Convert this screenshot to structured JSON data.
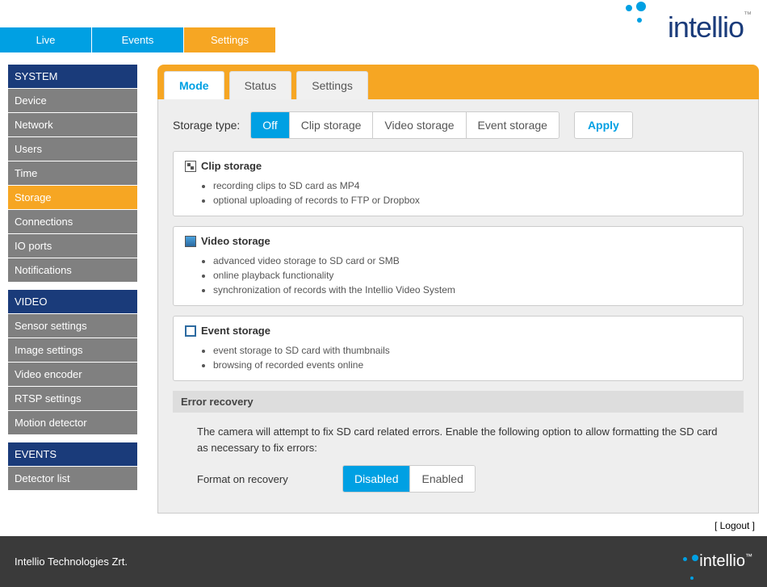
{
  "topnav": {
    "items": [
      {
        "label": "Live",
        "style": "blue"
      },
      {
        "label": "Events",
        "style": "blue"
      },
      {
        "label": "Settings",
        "style": "orange",
        "active": true
      }
    ]
  },
  "logo": {
    "text": "intellio",
    "tm": "™"
  },
  "sidebar": {
    "sections": [
      {
        "title": "SYSTEM",
        "items": [
          {
            "label": "Device"
          },
          {
            "label": "Network"
          },
          {
            "label": "Users"
          },
          {
            "label": "Time"
          },
          {
            "label": "Storage",
            "active": true
          },
          {
            "label": "Connections"
          },
          {
            "label": "IO ports"
          },
          {
            "label": "Notifications"
          }
        ]
      },
      {
        "title": "VIDEO",
        "items": [
          {
            "label": "Sensor settings"
          },
          {
            "label": "Image settings"
          },
          {
            "label": "Video encoder"
          },
          {
            "label": "RTSP settings"
          },
          {
            "label": "Motion detector"
          }
        ]
      },
      {
        "title": "EVENTS",
        "items": [
          {
            "label": "Detector list"
          }
        ]
      }
    ]
  },
  "tabs": [
    {
      "label": "Mode",
      "active": true
    },
    {
      "label": "Status"
    },
    {
      "label": "Settings"
    }
  ],
  "storage_type": {
    "label": "Storage type:",
    "options": [
      {
        "label": "Off",
        "active": true
      },
      {
        "label": "Clip storage"
      },
      {
        "label": "Video storage"
      },
      {
        "label": "Event storage"
      }
    ],
    "apply": "Apply"
  },
  "info_boxes": [
    {
      "title": "Clip storage",
      "icon": "clip",
      "items": [
        "recording clips to SD card as MP4",
        "optional uploading of records to FTP or Dropbox"
      ]
    },
    {
      "title": "Video storage",
      "icon": "vid",
      "items": [
        "advanced video storage to SD card or SMB",
        "online playback functionality",
        "synchronization of records with the Intellio Video System"
      ]
    },
    {
      "title": "Event storage",
      "icon": "evt",
      "items": [
        "event storage to SD card with thumbnails",
        "browsing of recorded events online"
      ]
    }
  ],
  "error_recovery": {
    "header": "Error recovery",
    "text": "The camera will attempt to fix SD card related errors. Enable the following option to allow formatting the SD card as necessary to fix errors:",
    "format_label": "Format on recovery",
    "options": [
      {
        "label": "Disabled",
        "active": true
      },
      {
        "label": "Enabled"
      }
    ]
  },
  "logout": "Logout",
  "footer": {
    "company": "Intellio Technologies Zrt.",
    "logo": "intellio"
  }
}
